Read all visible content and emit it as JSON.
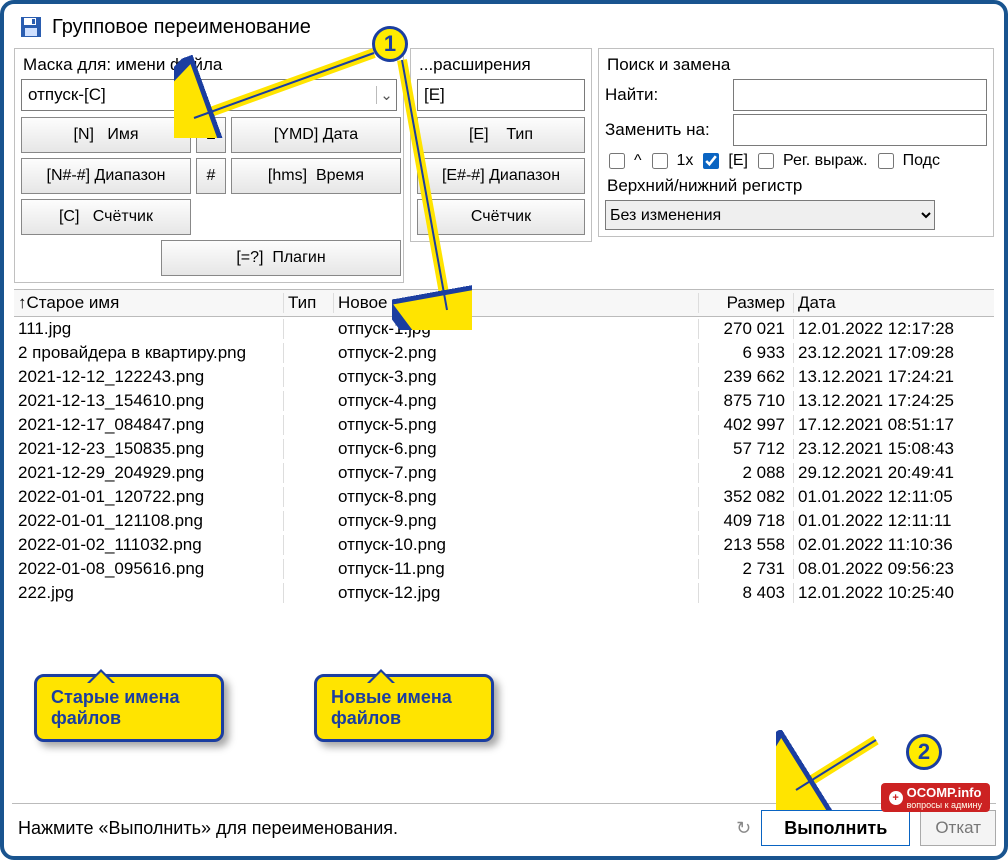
{
  "title": "Групповое переименование",
  "mask": {
    "name_label": "Маска для: имени файла",
    "ext_label": "...расширения",
    "name_value": "отпуск-[C]",
    "ext_value": "[E]",
    "buttons_name": [
      {
        "code": "[N]",
        "label": "Имя"
      },
      {
        "code": "±",
        "label": ""
      },
      {
        "code": "[YMD]",
        "label": "Дата"
      },
      {
        "code": "[N#-#]",
        "label": "Диапазон"
      },
      {
        "code": "#",
        "label": ""
      },
      {
        "code": "[hms]",
        "label": "Время"
      },
      {
        "code": "[C]",
        "label": "Счётчик"
      },
      {
        "code": "[=?]",
        "label": "Плагин"
      }
    ],
    "buttons_ext": [
      {
        "code": "[E]",
        "label": "Тип"
      },
      {
        "code": "[E#-#]",
        "label": "Диапазон"
      },
      {
        "code": "",
        "label": "Счётчик"
      }
    ]
  },
  "search": {
    "group_label": "Поиск и замена",
    "find_label": "Найти:",
    "replace_label": "Заменить на:",
    "chk_caret": "^",
    "chk_1x": "1x",
    "chk_E": "[E]",
    "chk_regex": "Рег. выраж.",
    "chk_subst": "Подс",
    "case_label": "Верхний/нижний регистр",
    "case_value": "Без изменения"
  },
  "columns": {
    "old": "Старое имя",
    "ext": "Тип",
    "new": "Новое имя",
    "size": "Размер",
    "date": "Дата"
  },
  "rows": [
    {
      "old": "111.jpg",
      "new": "отпуск-1.jpg",
      "size": "270 021",
      "date": "12.01.2022 12:17:28"
    },
    {
      "old": "2 провайдера в квартиру.png",
      "new": "отпуск-2.png",
      "size": "6 933",
      "date": "23.12.2021 17:09:28"
    },
    {
      "old": "2021-12-12_122243.png",
      "new": "отпуск-3.png",
      "size": "239 662",
      "date": "13.12.2021 17:24:21"
    },
    {
      "old": "2021-12-13_154610.png",
      "new": "отпуск-4.png",
      "size": "875 710",
      "date": "13.12.2021 17:24:25"
    },
    {
      "old": "2021-12-17_084847.png",
      "new": "отпуск-5.png",
      "size": "402 997",
      "date": "17.12.2021 08:51:17"
    },
    {
      "old": "2021-12-23_150835.png",
      "new": "отпуск-6.png",
      "size": "57 712",
      "date": "23.12.2021 15:08:43"
    },
    {
      "old": "2021-12-29_204929.png",
      "new": "отпуск-7.png",
      "size": "2 088",
      "date": "29.12.2021 20:49:41"
    },
    {
      "old": "2022-01-01_120722.png",
      "new": "отпуск-8.png",
      "size": "352 082",
      "date": "01.01.2022 12:11:05"
    },
    {
      "old": "2022-01-01_121108.png",
      "new": "отпуск-9.png",
      "size": "409 718",
      "date": "01.01.2022 12:11:11"
    },
    {
      "old": "2022-01-02_111032.png",
      "new": "отпуск-10.png",
      "size": "213 558",
      "date": "02.01.2022 11:10:36"
    },
    {
      "old": "2022-01-08_095616.png",
      "new": "отпуск-11.png",
      "size": "2 731",
      "date": "08.01.2022 09:56:23"
    },
    {
      "old": "222.jpg",
      "new": "отпуск-12.jpg",
      "size": "8 403",
      "date": "12.01.2022 10:25:40"
    }
  ],
  "bottom": {
    "status": "Нажмите «Выполнить» для переименования.",
    "do": "Выполнить",
    "undo": "Откат"
  },
  "annot": {
    "badge1": "1",
    "badge2": "2",
    "callout_old": "Старые имена файлов",
    "callout_new": "Новые имена файлов"
  },
  "watermark": {
    "main": "OCOMP.info",
    "sub": "вопросы к админу"
  }
}
